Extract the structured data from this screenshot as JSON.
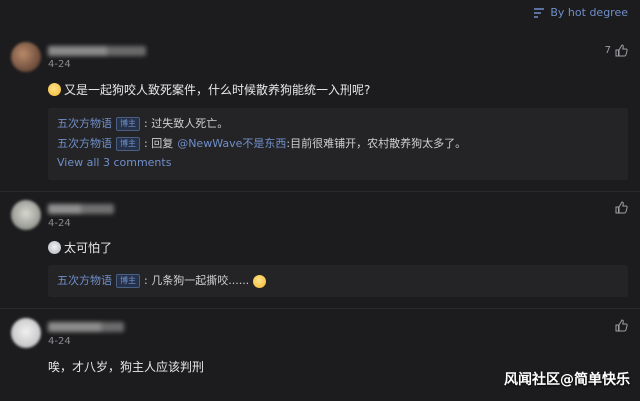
{
  "sort": {
    "label": "By hot degree",
    "icon": "sort-icon"
  },
  "comments": [
    {
      "date": "4-24",
      "like_count": "7",
      "text": "又是一起狗咬人致死案件，什么时候散养狗能统一入刑呢?",
      "replies": [
        {
          "author": "五次方物语",
          "badge": "博主",
          "text": ": 过失致人死亡。"
        },
        {
          "author": "五次方物语",
          "badge": "博主",
          "prefix": ": 回复",
          "mention": "@NewWave不是东西",
          "text": ":目前很难铺开，农村散养狗太多了。"
        }
      ],
      "view_all": "View all 3 comments"
    },
    {
      "date": "4-24",
      "like_count": "",
      "text": "太可怕了",
      "replies": [
        {
          "author": "五次方物语",
          "badge": "博主",
          "text": ": 几条狗一起撕咬......"
        }
      ]
    },
    {
      "date": "4-24",
      "like_count": "",
      "text": "唉，才八岁，狗主人应该判刑"
    }
  ],
  "watermark": "风闻社区@简单快乐",
  "colors": {
    "background": "#1c1c1e",
    "link": "#6f8fc9",
    "reply_bg": "#242427"
  }
}
